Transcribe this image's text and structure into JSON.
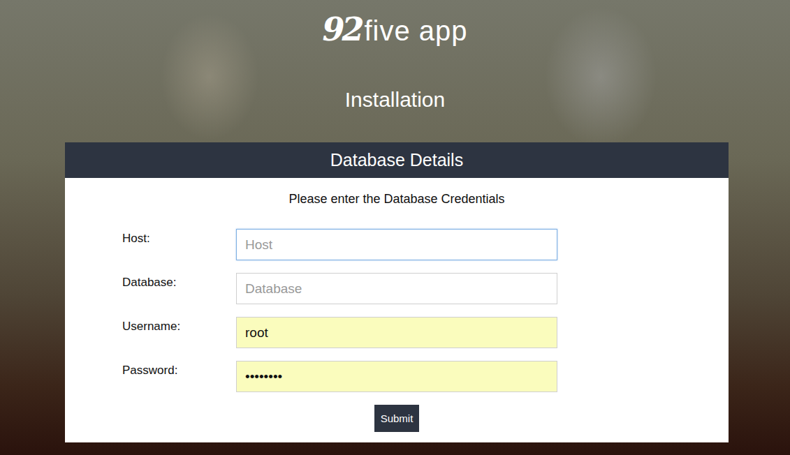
{
  "logo": {
    "mark": "92",
    "name": "five app"
  },
  "page": {
    "title": "Installation"
  },
  "panel": {
    "title": "Database Details",
    "prompt": "Please enter the Database Credentials"
  },
  "fields": [
    {
      "label": "Host:",
      "placeholder": "Host",
      "value": "",
      "focused": true,
      "autofilled": false
    },
    {
      "label": "Database:",
      "placeholder": "Database",
      "value": "",
      "focused": false,
      "autofilled": false
    },
    {
      "label": "Username:",
      "placeholder": "",
      "value": "root",
      "focused": false,
      "autofilled": true
    },
    {
      "label": "Password:",
      "placeholder": "",
      "value": "••••••••",
      "focused": false,
      "autofilled": true
    }
  ],
  "buttons": [
    "Submit"
  ]
}
